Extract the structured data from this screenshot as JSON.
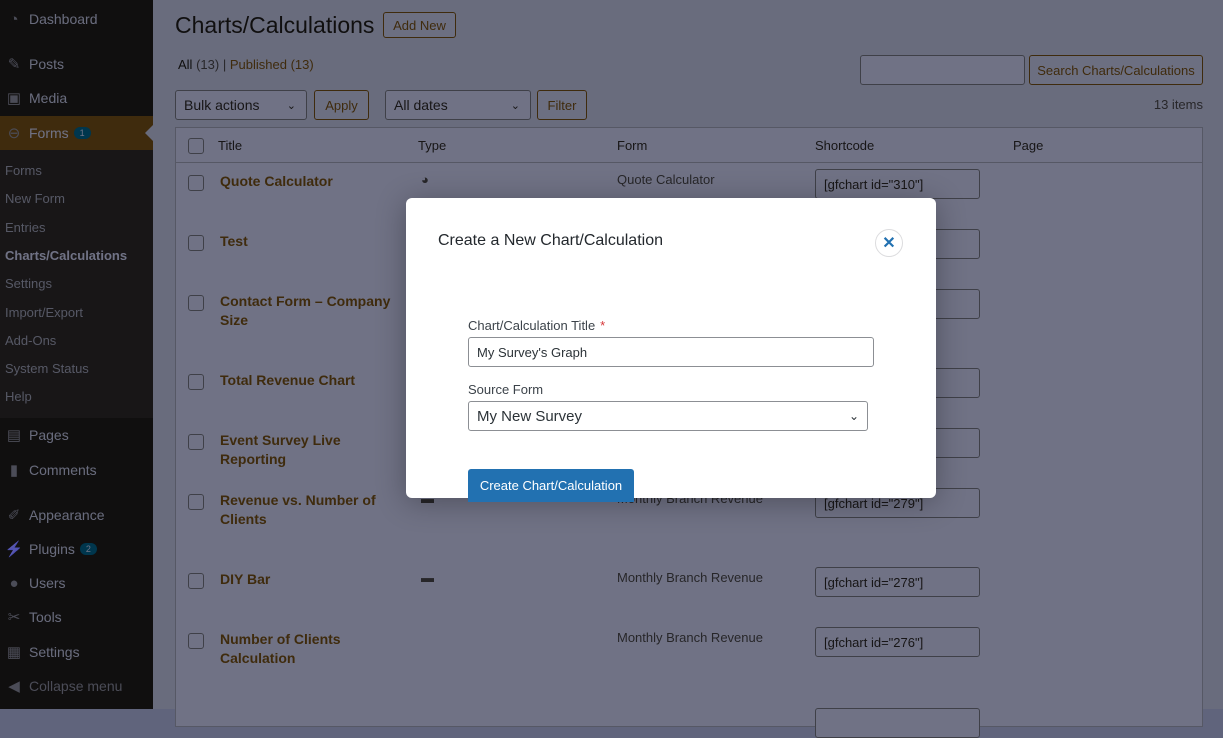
{
  "sidebar": {
    "items": [
      {
        "label": "Dashboard",
        "icon": "dashboard-icon"
      },
      {
        "label": "Posts",
        "icon": "pin-icon"
      },
      {
        "label": "Media",
        "icon": "media-icon"
      },
      {
        "label": "Forms",
        "icon": "forms-icon",
        "badge": "1"
      },
      {
        "label": "Pages",
        "icon": "pages-icon"
      },
      {
        "label": "Comments",
        "icon": "comment-icon"
      },
      {
        "label": "Appearance",
        "icon": "brush-icon"
      },
      {
        "label": "Plugins",
        "icon": "plugin-icon",
        "badge": "2"
      },
      {
        "label": "Users",
        "icon": "user-icon"
      },
      {
        "label": "Tools",
        "icon": "wrench-icon"
      },
      {
        "label": "Settings",
        "icon": "settings-icon"
      },
      {
        "label": "Collapse menu",
        "icon": "collapse-icon"
      }
    ],
    "submenu": [
      "Forms",
      "New Form",
      "Entries",
      "Charts/Calculations",
      "Settings",
      "Import/Export",
      "Add-Ons",
      "System Status",
      "Help"
    ]
  },
  "header": {
    "title": "Charts/Calculations",
    "add_new": "Add New"
  },
  "filters": {
    "all": "All",
    "all_count": "(13)",
    "published": "Published",
    "published_count": "(13)",
    "bulk": "Bulk actions",
    "apply": "Apply",
    "dates": "All dates",
    "filter": "Filter",
    "search_button": "Search Charts/Calculations",
    "search_value": "",
    "items": "13 items"
  },
  "table": {
    "columns": [
      "Title",
      "Type",
      "Form",
      "Shortcode",
      "Page"
    ],
    "rows": [
      {
        "title": "Quote Calculator",
        "type": "pie",
        "form": "Quote Calculator",
        "shortcode": "[gfchart id=\"310\"]"
      },
      {
        "title": "Test",
        "type": "",
        "form": "",
        "shortcode": ""
      },
      {
        "title": "Contact Form – Company Size",
        "type": "",
        "form": "",
        "shortcode": ""
      },
      {
        "title": "Total Revenue Chart",
        "type": "",
        "form": "",
        "shortcode": ""
      },
      {
        "title": "Event Survey Live Reporting",
        "type": "",
        "form": "",
        "shortcode": ""
      },
      {
        "title": "Revenue vs. Number of Clients",
        "type": "bar",
        "form": "Monthly Branch Revenue",
        "shortcode": "[gfchart id=\"279\"]"
      },
      {
        "title": "DIY Bar",
        "type": "bar",
        "form": "Monthly Branch Revenue",
        "shortcode": "[gfchart id=\"278\"]"
      },
      {
        "title": "Number of Clients Calculation",
        "type": "",
        "form": "Monthly Branch Revenue",
        "shortcode": "[gfchart id=\"276\"]"
      }
    ]
  },
  "modal": {
    "title": "Create a New Chart/Calculation",
    "title_label": "Chart/Calculation Title",
    "required": "*",
    "title_value": "My Survey's Graph",
    "source_label": "Source Form",
    "source_value": "My New Survey",
    "create": "Create Chart/Calculation"
  }
}
